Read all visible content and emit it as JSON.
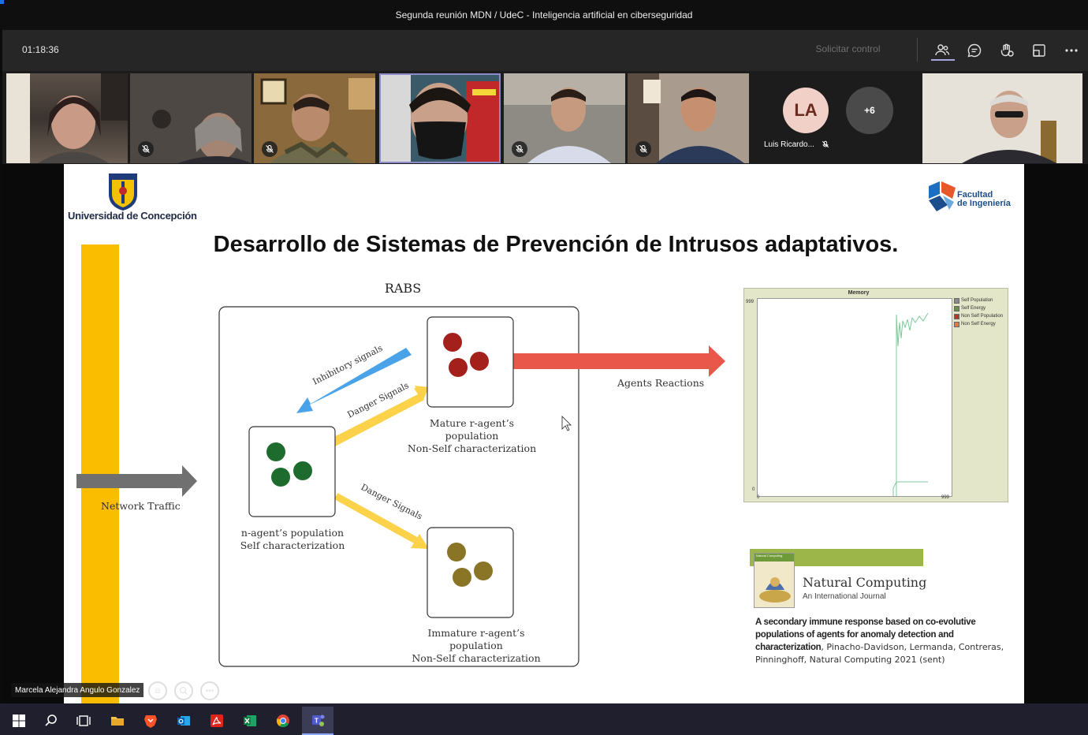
{
  "window": {
    "title": "Segunda reunión MDN / UdeC - Inteligencia artificial en ciberseguridad"
  },
  "toolbar": {
    "timer": "01:18:36",
    "request_control": "Solicitar control",
    "icons": [
      "people-icon",
      "chat-icon",
      "reactions-icon",
      "share-tray-icon",
      "more-icon"
    ]
  },
  "participants": {
    "la_initials": "LA",
    "la_name": "Luis Ricardo...",
    "overflow_count": "+6"
  },
  "slide": {
    "university": "Universidad de Concepción",
    "faculty_line1": "Facultad",
    "faculty_line2": "de Ingeniería",
    "title": "Desarrollo de Sistemas de Prevención de Intrusos adaptativos.",
    "rabs": "RABS",
    "inhibitory_signals": "Inhibitory signals",
    "danger_signals_upper": "Danger Signals",
    "danger_signals_lower": "Danger Signals",
    "agents_reactions": "Agents Reactions",
    "network_traffic": "Network Traffic",
    "mature_line1": "Mature r-agent’s population",
    "mature_line2": "Non-Self characterization",
    "nagent_line1": "n-agent’s population",
    "nagent_line2": "Self characterization",
    "immature_line1": "Immature r-agent’s population",
    "immature_line2": "Non-Self characterization",
    "memory_chart": {
      "title": "Memory",
      "y_max": "999",
      "y_min": "0",
      "x_min": "0",
      "x_max": "999",
      "legend": [
        {
          "label": "Self Population",
          "color": "#8a8a8a"
        },
        {
          "label": "Self Energy",
          "color": "#6b8e4e"
        },
        {
          "label": "Non Self Population",
          "color": "#b23a2a"
        },
        {
          "label": "Non Self Energy",
          "color": "#e07b39"
        }
      ]
    },
    "journal": {
      "cover_title": "Natural Computing",
      "title": "Natural Computing",
      "subtitle": "An International Journal"
    },
    "reference": {
      "bold": "A secondary immune response based on co-evolutive populations of agents for anomaly detection and characterization",
      "authors": ", Pinacho-Davidson, Lermanda, Contreras, Pinninghoff, Natural Computing 2021 (sent)"
    }
  },
  "presenter": {
    "name": "Marcela Alejandra Angulo Gonzalez"
  },
  "colors": {
    "yellow_bar": "#fbbd00",
    "mature_cells": "#a3201b",
    "nagent_cells": "#1e6b2e",
    "immature_cells": "#8a7425",
    "reaction_arrow": "#e8574a",
    "inhibitory_arrow": "#4aa3e8",
    "danger_arrow": "#fbd24a",
    "traffic_arrow": "#707070"
  }
}
